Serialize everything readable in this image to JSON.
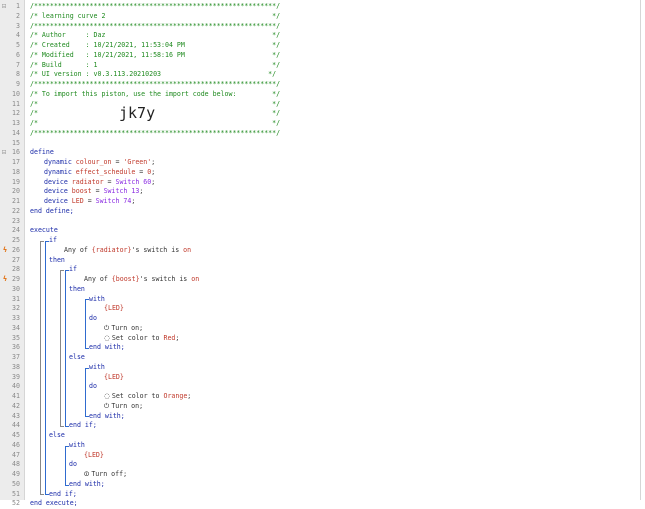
{
  "header_comment": {
    "border": "/*************************************************************/",
    "title": "/* learning curve 2                                          */",
    "author": "/* Author     : Daz                                          */",
    "created": "/* Created    : 10/21/2021, 11:53:04 PM                      */",
    "modified": "/* Modified   : 10/21/2021, 11:58:16 PM                      */",
    "build": "/* Build      : 1                                            */",
    "ui_version": "/* UI version : v0.3.113.20210203                           */",
    "import_text": "/* To import this piston, use the import code below:         */",
    "empty": "/*                                                           */",
    "import_code": "jk7y"
  },
  "code": {
    "define": "define",
    "def_colour": [
      "dynamic ",
      "colour_on",
      " = ",
      "'Green'",
      ";"
    ],
    "def_effect": [
      "dynamic ",
      "effect_schedule",
      " = ",
      "0",
      ";"
    ],
    "def_radiator": [
      "device ",
      "radiator",
      " = ",
      "Switch 60",
      ";"
    ],
    "def_boost": [
      "device ",
      "boost",
      " = ",
      "Switch 13",
      ";"
    ],
    "def_led": [
      "device ",
      "LED",
      " = ",
      "Switch 74",
      ";"
    ],
    "end_define": "end define;",
    "execute": "execute",
    "if": "if",
    "then": "then",
    "else": "else",
    "end_if": "end if;",
    "with": "with",
    "do": "do",
    "end_with": "end with;",
    "end_execute": "end execute;",
    "cond_radiator": [
      "Any of ",
      "{radiator}",
      "'s ",
      "switch",
      " is ",
      "on"
    ],
    "cond_boost": [
      "Any of ",
      "{boost}",
      "'s ",
      "switch",
      " is ",
      "on"
    ],
    "led_ref": "{LED}",
    "turn_on": "Turn on;",
    "turn_off": "Turn off;",
    "set_color_red": [
      "Set color to ",
      "Red",
      ";"
    ],
    "set_color_orange": [
      "Set color to ",
      "Orange",
      ";"
    ]
  },
  "line_numbers": [
    "1",
    "2",
    "3",
    "4",
    "5",
    "6",
    "7",
    "8",
    "9",
    "10",
    "11",
    "12",
    "13",
    "14",
    "15",
    "16",
    "17",
    "18",
    "19",
    "20",
    "21",
    "22",
    "23",
    "24",
    "25",
    "26",
    "27",
    "28",
    "29",
    "30",
    "31",
    "32",
    "33",
    "34",
    "35",
    "36",
    "37",
    "38",
    "39",
    "40",
    "41",
    "42",
    "43",
    "44",
    "45",
    "46",
    "47",
    "48",
    "49",
    "50",
    "51",
    "52"
  ],
  "icons": {
    "fold": "minus-square-icon",
    "condition_marker": "lightning-icon",
    "power": "power-icon",
    "palette": "palette-icon"
  },
  "colors": {
    "comment": "#1f8a1f",
    "keyword": "#1a2aa8",
    "variable": "#c0392b",
    "device": "#8a2be2",
    "marker": "#e2761b",
    "bracket": "#2f6bcf"
  }
}
